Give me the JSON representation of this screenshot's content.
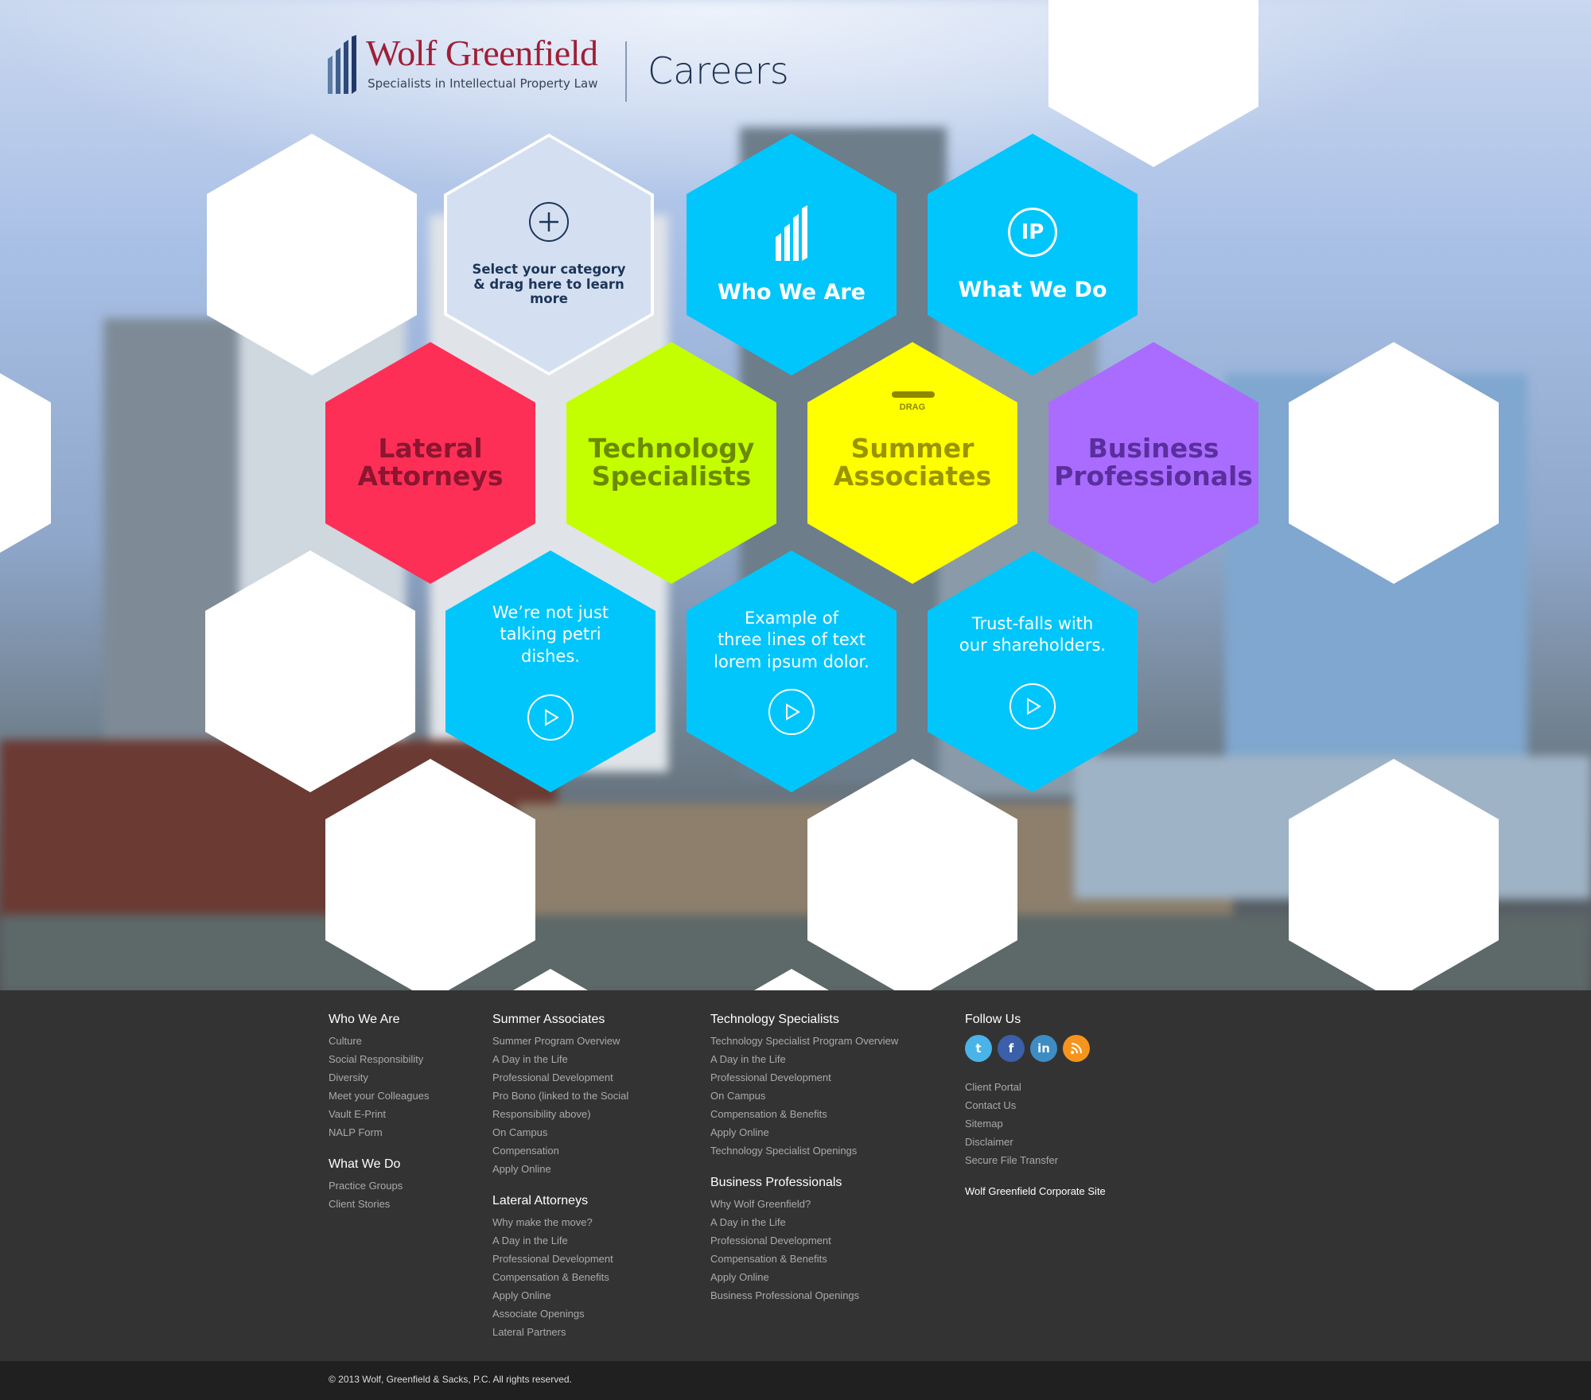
{
  "header": {
    "brand_name": "Wolf Greenfield",
    "brand_tagline": "Specialists in Intellectual Property Law",
    "section_title": "Careers"
  },
  "drop_zone": {
    "text": "Select your category & drag here to learn more"
  },
  "nav_hexes": {
    "who_we_are": "Who We Are",
    "what_we_do": "What We Do",
    "ip_icon_text": "IP"
  },
  "categories": [
    {
      "label": "Lateral\nAttorneys",
      "color": "#fe2f56",
      "text_color": "#8c1530"
    },
    {
      "label": "Technology\nSpecialists",
      "color": "#c4ff00",
      "text_color": "#6b8a00"
    },
    {
      "label": "Summer\nAssociates",
      "color": "#ffff00",
      "text_color": "#9a9400"
    },
    {
      "label": "Business\nProfessionals",
      "color": "#a96cff",
      "text_color": "#5b2e9e"
    }
  ],
  "drag_hint": "DRAG",
  "videos": [
    {
      "caption": "We’re not just\ntalking petri dishes."
    },
    {
      "caption": "Example of\nthree lines of text\nlorem ipsum dolor."
    },
    {
      "caption": "Trust-falls with\nour shareholders."
    }
  ],
  "colors": {
    "accent_blue": "#00c6fb",
    "footer_bg": "#333333",
    "bottom_bar_bg": "#202020"
  },
  "footer": {
    "col1": [
      {
        "heading": "Who We Are",
        "links": [
          "Culture",
          "Social Responsibility",
          "Diversity",
          "Meet your Colleagues",
          "Vault E-Print",
          "NALP Form"
        ]
      },
      {
        "heading": "What We Do",
        "links": [
          "Practice Groups",
          "Client Stories"
        ]
      }
    ],
    "col2": [
      {
        "heading": "Summer Associates",
        "links": [
          "Summer Program Overview",
          "A Day in the Life",
          "Professional Development",
          "Pro Bono (linked to the Social",
          "Responsibility above)",
          "On Campus",
          "Compensation",
          "Apply Online"
        ]
      },
      {
        "heading": "Lateral Attorneys",
        "links": [
          "Why make the move?",
          "A Day in the Life",
          "Professional Development",
          "Compensation & Benefits",
          "Apply Online",
          "Associate Openings",
          "Lateral Partners"
        ]
      }
    ],
    "col3": [
      {
        "heading": "Technology Specialists",
        "links": [
          "Technology Specialist Program Overview",
          "A Day in the Life",
          "Professional Development",
          "On Campus",
          "Compensation & Benefits",
          "Apply Online",
          "Technology Specialist Openings"
        ]
      },
      {
        "heading": "Business Professionals",
        "links": [
          "Why Wolf Greenfield?",
          "A Day in the Life",
          "Professional Development",
          "Compensation & Benefits",
          "Apply Online",
          "Business Professional Openings"
        ]
      }
    ],
    "follow": {
      "heading": "Follow Us",
      "social": [
        {
          "icon": "twitter-icon",
          "glyph": "t",
          "color": "#4ab3e8"
        },
        {
          "icon": "facebook-icon",
          "glyph": "f",
          "color": "#3b5fa8"
        },
        {
          "icon": "linkedin-icon",
          "glyph": "in",
          "color": "#3d8cc4"
        },
        {
          "icon": "rss-icon",
          "glyph": "",
          "color": "#f7941d"
        }
      ],
      "links": [
        "Client Portal",
        "Contact Us",
        "Sitemap",
        "Disclaimer",
        "Secure File Transfer"
      ],
      "corporate_link": "Wolf Greenfield Corporate Site"
    },
    "copyright": "© 2013 Wolf, Greenfield & Sacks, P.C. All rights reserved."
  }
}
